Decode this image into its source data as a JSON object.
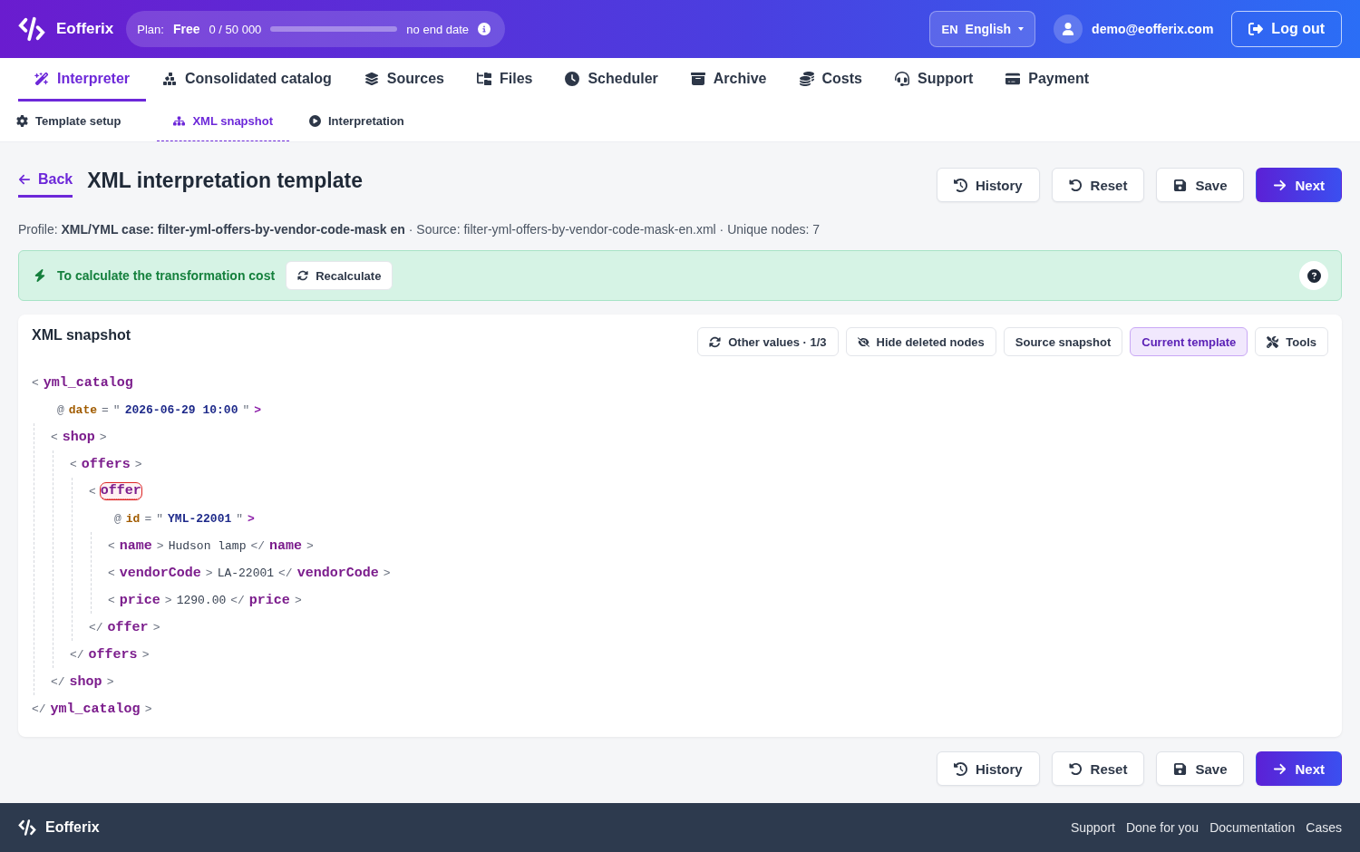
{
  "header": {
    "brand": "Eofferix",
    "plan": {
      "label": "Plan:",
      "name": "Free",
      "usage": "0 / 50 000",
      "level": 0,
      "end": "no end date"
    },
    "language": {
      "code": "EN",
      "name": "English"
    },
    "user": "demo@eofferix.com",
    "logout": "Log out"
  },
  "nav": [
    {
      "label": "Interpreter",
      "selected": true
    },
    {
      "label": "Consolidated catalog",
      "selected": false
    },
    {
      "label": "Sources",
      "selected": false
    },
    {
      "label": "Files",
      "selected": false
    },
    {
      "label": "Scheduler",
      "selected": false
    },
    {
      "label": "Archive",
      "selected": false
    },
    {
      "label": "Costs",
      "selected": false
    },
    {
      "label": "Support",
      "selected": false
    },
    {
      "label": "Payment",
      "selected": false
    }
  ],
  "subnav": [
    {
      "label": "Template setup",
      "selected": false
    },
    {
      "label": "XML snapshot",
      "selected": true
    },
    {
      "label": "Interpretation",
      "selected": false
    }
  ],
  "page": {
    "back": "Back",
    "title": "XML interpretation template",
    "actions": [
      {
        "label": "History",
        "kind": "default"
      },
      {
        "label": "Reset",
        "kind": "default"
      },
      {
        "label": "Save",
        "kind": "default"
      },
      {
        "label": "Next",
        "kind": "primary"
      }
    ]
  },
  "info": "Profile: **XML/YML case: filter-yml-offers-by-vendor-code-mask en** · Source: filter-yml-offers-by-vendor-code-mask-en.xml · Unique nodes: 7",
  "banner": {
    "text": "To calculate the transformation cost",
    "button": "Recalculate"
  },
  "snapshot": {
    "title": "XML snapshot",
    "tools": [
      {
        "label": "Other values · 1/3",
        "selected": false
      },
      {
        "label": "Hide deleted nodes",
        "selected": false
      },
      {
        "label": "Source snapshot",
        "selected": false
      },
      {
        "label": "Current template",
        "selected": true
      },
      {
        "label": "Tools",
        "selected": false
      }
    ],
    "tree": {
      "open": [
        {
          "kind": "punct",
          "text": "<"
        },
        {
          "kind": "tag",
          "text": "yml_catalog"
        }
      ],
      "attributes": [
        [
          {
            "kind": "punct",
            "text": "@"
          },
          {
            "kind": "attr",
            "text": "date"
          },
          {
            "kind": "punct",
            "text": "="
          },
          {
            "kind": "punct",
            "text": "\""
          },
          {
            "kind": "value",
            "text": "2026-06-29 10:00"
          },
          {
            "kind": "punct",
            "text": "\""
          },
          {
            "kind": "arrow",
            "text": ">"
          }
        ]
      ],
      "children": [
        {
          "open": [
            {
              "kind": "punct",
              "text": "<"
            },
            {
              "kind": "tag",
              "text": "shop"
            },
            {
              "kind": "punct",
              "text": ">"
            }
          ],
          "children": [
            {
              "open": [
                {
                  "kind": "punct",
                  "text": "<"
                },
                {
                  "kind": "tag",
                  "text": "offers"
                },
                {
                  "kind": "punct",
                  "text": ">"
                }
              ],
              "children": [
                {
                  "open": [
                    {
                      "kind": "punct",
                      "text": "<"
                    },
                    {
                      "kind": "tag",
                      "text": "offer",
                      "highlighted": true
                    }
                  ],
                  "attributes": [
                    [
                      {
                        "kind": "punct",
                        "text": "@"
                      },
                      {
                        "kind": "attr",
                        "text": "id"
                      },
                      {
                        "kind": "punct",
                        "text": "="
                      },
                      {
                        "kind": "punct",
                        "text": "\""
                      },
                      {
                        "kind": "value",
                        "text": "YML-22001"
                      },
                      {
                        "kind": "punct",
                        "text": "\""
                      },
                      {
                        "kind": "arrow",
                        "text": ">"
                      }
                    ]
                  ],
                  "children": [
                    {
                      "open": [
                        {
                          "kind": "punct",
                          "text": "<"
                        },
                        {
                          "kind": "tag",
                          "text": "name"
                        },
                        {
                          "kind": "punct",
                          "text": ">"
                        },
                        {
                          "kind": "text",
                          "text": "Hudson lamp"
                        },
                        {
                          "kind": "punct",
                          "text": "</"
                        },
                        {
                          "kind": "tag",
                          "text": "name"
                        },
                        {
                          "kind": "punct",
                          "text": ">"
                        }
                      ]
                    },
                    {
                      "open": [
                        {
                          "kind": "punct",
                          "text": "<"
                        },
                        {
                          "kind": "tag",
                          "text": "vendorCode"
                        },
                        {
                          "kind": "punct",
                          "text": ">"
                        },
                        {
                          "kind": "text",
                          "text": "LA-22001"
                        },
                        {
                          "kind": "punct",
                          "text": "</"
                        },
                        {
                          "kind": "tag",
                          "text": "vendorCode"
                        },
                        {
                          "kind": "punct",
                          "text": ">"
                        }
                      ]
                    },
                    {
                      "open": [
                        {
                          "kind": "punct",
                          "text": "<"
                        },
                        {
                          "kind": "tag",
                          "text": "price"
                        },
                        {
                          "kind": "punct",
                          "text": ">"
                        },
                        {
                          "kind": "text",
                          "text": "1290.00"
                        },
                        {
                          "kind": "punct",
                          "text": "</"
                        },
                        {
                          "kind": "tag",
                          "text": "price"
                        },
                        {
                          "kind": "punct",
                          "text": ">"
                        }
                      ]
                    }
                  ],
                  "close": [
                    {
                      "kind": "punct",
                      "text": "</"
                    },
                    {
                      "kind": "tag",
                      "text": "offer"
                    },
                    {
                      "kind": "punct",
                      "text": ">"
                    }
                  ]
                }
              ],
              "close": [
                {
                  "kind": "punct",
                  "text": "</"
                },
                {
                  "kind": "tag",
                  "text": "offers"
                },
                {
                  "kind": "punct",
                  "text": ">"
                }
              ]
            }
          ],
          "close": [
            {
              "kind": "punct",
              "text": "</"
            },
            {
              "kind": "tag",
              "text": "shop"
            },
            {
              "kind": "punct",
              "text": ">"
            }
          ]
        }
      ],
      "close": [
        {
          "kind": "punct",
          "text": "</"
        },
        {
          "kind": "tag",
          "text": "yml_catalog"
        },
        {
          "kind": "punct",
          "text": ">"
        }
      ]
    }
  },
  "bottom_actions": [
    {
      "label": "History",
      "kind": "default"
    },
    {
      "label": "Reset",
      "kind": "default"
    },
    {
      "label": "Save",
      "kind": "default"
    },
    {
      "label": "Next",
      "kind": "primary"
    }
  ],
  "footer": {
    "brand": "Eofferix",
    "links": [
      "Support",
      "Done for you",
      "Documentation",
      "Cases"
    ]
  }
}
